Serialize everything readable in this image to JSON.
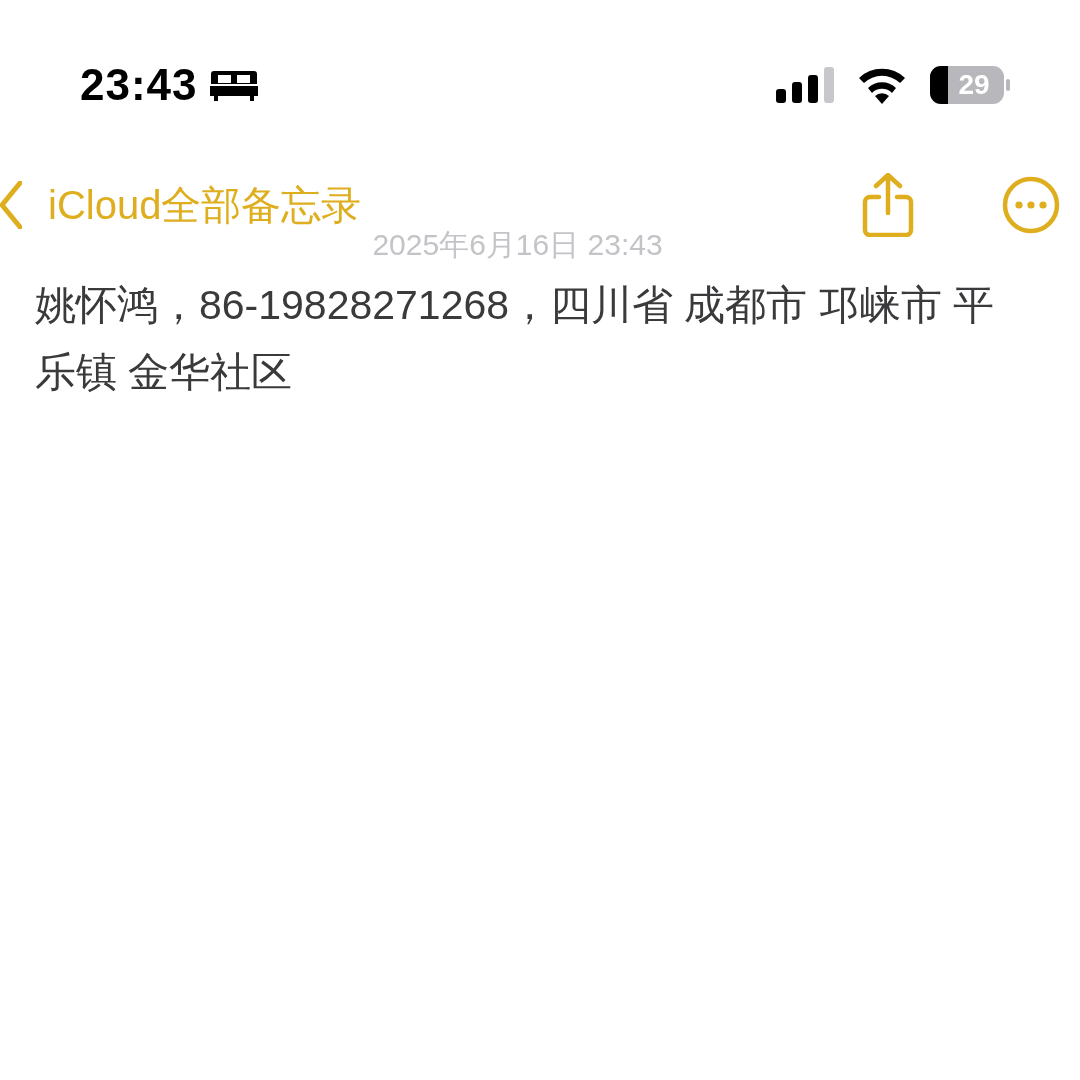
{
  "status_bar": {
    "time": "23:43",
    "battery": "29"
  },
  "nav": {
    "back_label": "iCloud全部备忘录"
  },
  "note": {
    "date": "2025年6月16日 23:43",
    "body": "姚怀鸿，86-19828271268，四川省 成都市 邛崃市 平乐镇 金华社区"
  }
}
